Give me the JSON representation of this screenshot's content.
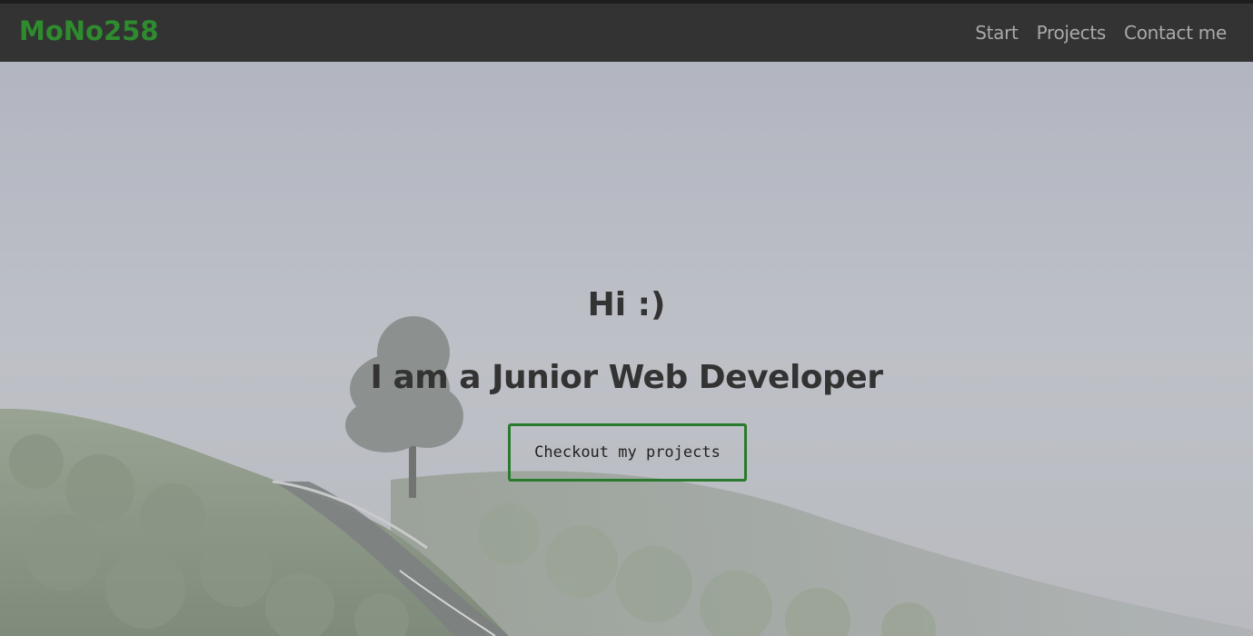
{
  "navbar": {
    "brand": "MoNo258",
    "links": [
      {
        "label": "Start"
      },
      {
        "label": "Projects"
      },
      {
        "label": "Contact me"
      }
    ]
  },
  "hero": {
    "greeting": "Hi :)",
    "subtitle": "I am a Junior Web Developer",
    "cta_label": "Checkout my projects"
  },
  "colors": {
    "brand": "#2e8b2e",
    "navbar_bg": "#333333",
    "nav_link": "#a9a9a9",
    "heading_text": "#333333",
    "cta_border": "#2a7a2e"
  }
}
